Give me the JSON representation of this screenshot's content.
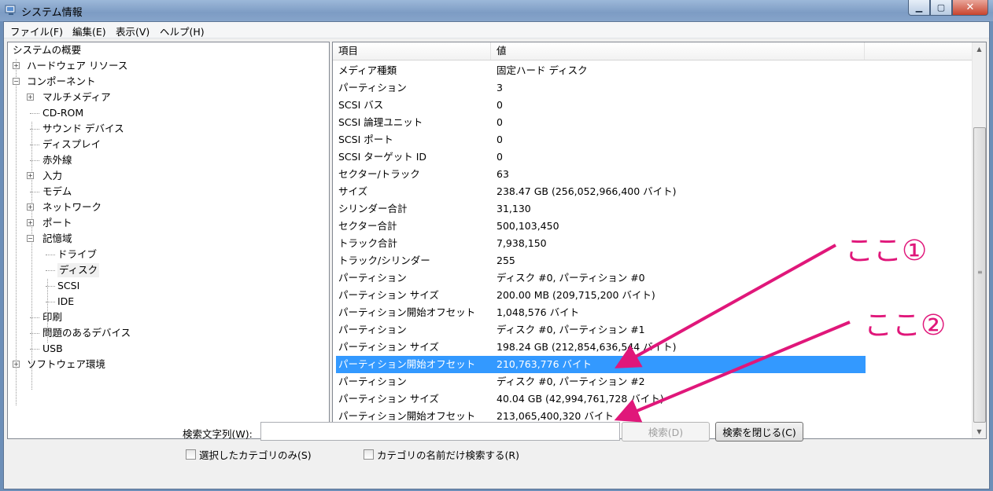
{
  "window": {
    "title": "システム情報"
  },
  "menu": [
    "ファイル(F)",
    "編集(E)",
    "表示(V)",
    "ヘルプ(H)"
  ],
  "tree": [
    {
      "label": "システムの概要",
      "level": 0,
      "expander": "none"
    },
    {
      "label": "ハードウェア リソース",
      "level": 1,
      "expander": "plus"
    },
    {
      "label": "コンポーネント",
      "level": 1,
      "expander": "minus"
    },
    {
      "label": "マルチメディア",
      "level": 2,
      "expander": "plus"
    },
    {
      "label": "CD-ROM",
      "level": 2,
      "expander": "none"
    },
    {
      "label": "サウンド デバイス",
      "level": 2,
      "expander": "none"
    },
    {
      "label": "ディスプレイ",
      "level": 2,
      "expander": "none"
    },
    {
      "label": "赤外線",
      "level": 2,
      "expander": "none"
    },
    {
      "label": "入力",
      "level": 2,
      "expander": "plus"
    },
    {
      "label": "モデム",
      "level": 2,
      "expander": "none"
    },
    {
      "label": "ネットワーク",
      "level": 2,
      "expander": "plus"
    },
    {
      "label": "ポート",
      "level": 2,
      "expander": "plus"
    },
    {
      "label": "記憶域",
      "level": 2,
      "expander": "minus"
    },
    {
      "label": "ドライブ",
      "level": 3,
      "expander": "none"
    },
    {
      "label": "ディスク",
      "level": 3,
      "expander": "none",
      "selected": true
    },
    {
      "label": "SCSI",
      "level": 3,
      "expander": "none"
    },
    {
      "label": "IDE",
      "level": 3,
      "expander": "none"
    },
    {
      "label": "印刷",
      "level": 2,
      "expander": "none"
    },
    {
      "label": "問題のあるデバイス",
      "level": 2,
      "expander": "none"
    },
    {
      "label": "USB",
      "level": 2,
      "expander": "none"
    },
    {
      "label": "ソフトウェア環境",
      "level": 1,
      "expander": "plus"
    }
  ],
  "list": {
    "columns": [
      "項目",
      "値"
    ],
    "rows": [
      [
        "メディア種類",
        "固定ハード ディスク"
      ],
      [
        "パーティション",
        "3"
      ],
      [
        "SCSI バス",
        "0"
      ],
      [
        "SCSI 論理ユニット",
        "0"
      ],
      [
        "SCSI ポート",
        "0"
      ],
      [
        "SCSI ターゲット ID",
        "0"
      ],
      [
        "セクター/トラック",
        "63"
      ],
      [
        "サイズ",
        "238.47 GB (256,052,966,400 バイト)"
      ],
      [
        "シリンダー合計",
        "31,130"
      ],
      [
        "セクター合計",
        "500,103,450"
      ],
      [
        "トラック合計",
        "7,938,150"
      ],
      [
        "トラック/シリンダー",
        "255"
      ],
      [
        "パーティション",
        "ディスク #0, パーティション #0"
      ],
      [
        "パーティション サイズ",
        "200.00 MB (209,715,200 バイト)"
      ],
      [
        "パーティション開始オフセット",
        "1,048,576 バイト"
      ],
      [
        "パーティション",
        "ディスク #0, パーティション #1"
      ],
      [
        "パーティション サイズ",
        "198.24 GB (212,854,636,544 バイト)"
      ],
      [
        "パーティション開始オフセット",
        "210,763,776 バイト"
      ],
      [
        "パーティション",
        "ディスク #0, パーティション #2"
      ],
      [
        "パーティション サイズ",
        "40.04 GB (42,994,761,728 バイト)"
      ],
      [
        "パーティション開始オフセット",
        "213,065,400,320 バイト"
      ]
    ],
    "selected_index": 17
  },
  "annotations": {
    "label1": "ここ①",
    "label2": "ここ②",
    "color": "#e0177a"
  },
  "search": {
    "label": "検索文字列(W):",
    "value": "",
    "find_button": "検索(D)",
    "close_button": "検索を閉じる(C)",
    "checkbox1": "選択したカテゴリのみ(S)",
    "checkbox2": "カテゴリの名前だけ検索する(R)"
  },
  "colors": {
    "selection": "#3399ff"
  }
}
